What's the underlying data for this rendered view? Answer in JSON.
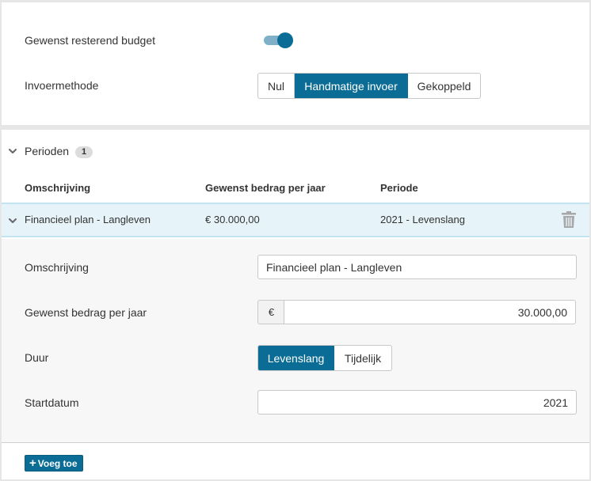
{
  "budget": {
    "label": "Gewenst resterend budget",
    "toggle_on": true
  },
  "method": {
    "label": "Invoermethode",
    "options": [
      "Nul",
      "Handmatige invoer",
      "Gekoppeld"
    ],
    "selected": "Handmatige invoer"
  },
  "periods": {
    "title": "Perioden",
    "count": "1",
    "columns": [
      "Omschrijving",
      "Gewenst bedrag per jaar",
      "Periode"
    ],
    "rows": [
      {
        "description": "Financieel plan - Langleven",
        "amount": "€ 30.000,00",
        "period": "2021 - Levenslang"
      }
    ]
  },
  "detail": {
    "description_label": "Omschrijving",
    "description_value": "Financieel plan - Langleven",
    "amount_label": "Gewenst bedrag per jaar",
    "currency": "€",
    "amount_value": "30.000,00",
    "duration_label": "Duur",
    "duration_options": [
      "Levenslang",
      "Tijdelijk"
    ],
    "duration_selected": "Levenslang",
    "start_label": "Startdatum",
    "start_value": "2021"
  },
  "add_button": {
    "label": "Voeg toe"
  },
  "colors": {
    "accent": "#0b6d95",
    "toggle_track": "#7fb0c8",
    "row_highlight": "#e6f4fa"
  }
}
